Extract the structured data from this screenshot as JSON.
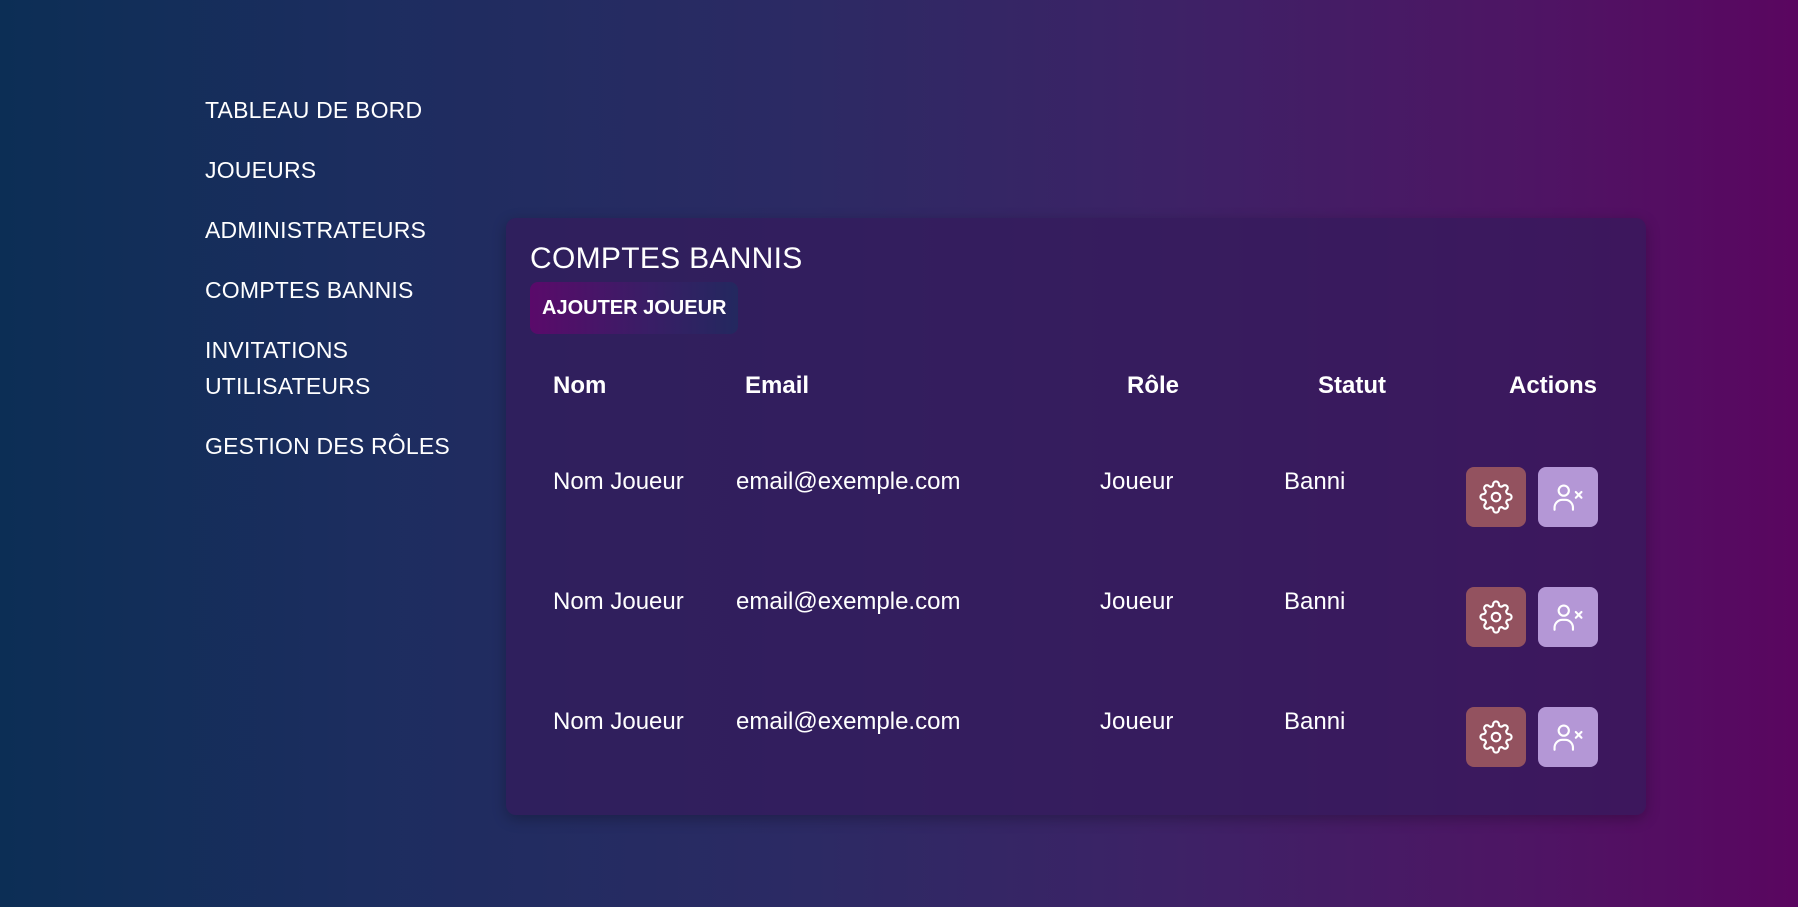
{
  "sidebar": {
    "items": [
      {
        "label": "TABLEAU DE BORD"
      },
      {
        "label": "JOUEURS"
      },
      {
        "label": "ADMINISTRATEURS"
      },
      {
        "label": "COMPTES BANNIS"
      },
      {
        "label": "INVITATIONS UTILISATEURS"
      },
      {
        "label": "GESTION DES RÔLES"
      }
    ]
  },
  "panel": {
    "title": "COMPTES BANNIS",
    "add_button_label": "AJOUTER JOUEUR"
  },
  "table": {
    "headers": {
      "name": "Nom",
      "email": "Email",
      "role": "Rôle",
      "status": "Statut",
      "actions": "Actions"
    },
    "rows": [
      {
        "name": "Nom Joueur",
        "email": "email@exemple.com",
        "role": "Joueur",
        "status": "Banni",
        "action_icons": [
          "gear-icon",
          "user-remove-icon"
        ]
      },
      {
        "name": "Nom Joueur",
        "email": "email@exemple.com",
        "role": "Joueur",
        "status": "Banni",
        "action_icons": [
          "gear-icon",
          "user-remove-icon"
        ]
      },
      {
        "name": "Nom Joueur",
        "email": "email@exemple.com",
        "role": "Joueur",
        "status": "Banni",
        "action_icons": [
          "gear-icon",
          "user-remove-icon"
        ]
      }
    ]
  },
  "colors": {
    "settings_button": "#93525f",
    "unban_button": "#b497d6"
  }
}
